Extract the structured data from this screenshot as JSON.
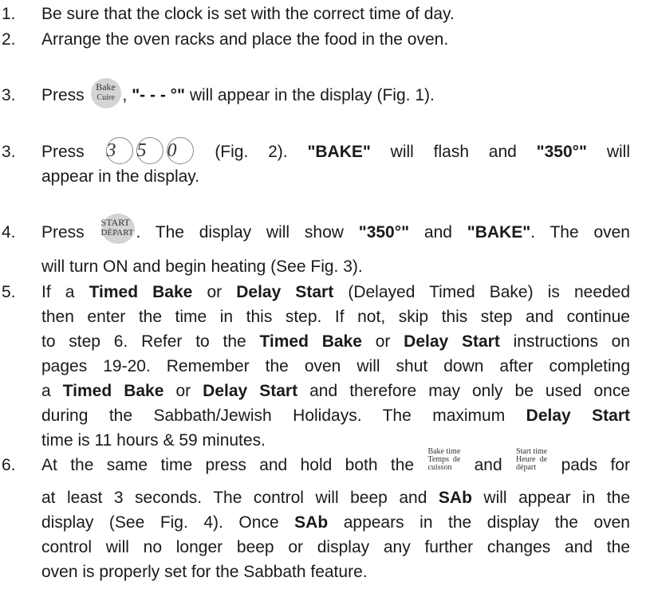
{
  "steps": {
    "s1": {
      "num": "1.",
      "text": "Be sure that the clock is set with the correct time of day."
    },
    "s2": {
      "num": "2.",
      "text": "Arrange the oven racks and place the food in the oven."
    },
    "s3a": {
      "num": "3.",
      "press": "Press",
      "pad_line1": "Bake",
      "pad_line2": "Cuire",
      "after_pad": ",",
      "display": "\"- - - °\"",
      "rest": "will appear in the display (Fig. 1)."
    },
    "s3b": {
      "num": "3.",
      "press": "Press",
      "digits": [
        "3",
        "5",
        "0"
      ],
      "fig": "(Fig. 2).",
      "bake": "\"BAKE\"",
      "mid": "will flash and",
      "temp": "\"350°\"",
      "end": "will",
      "line2": "appear in the display."
    },
    "s4": {
      "num": "4.",
      "press": "Press",
      "pad_line1": "START",
      "pad_line2": "DÉPART",
      "mid": ". The display will show",
      "temp": "\"350°\"",
      "and": "and",
      "bake": "\"BAKE\"",
      "end": ". The oven",
      "line2": "will turn ON and begin heating (See Fig. 3)."
    },
    "s5": {
      "num": "5.",
      "l1a": "If a",
      "tb": "Timed Bake",
      "l1b": "or",
      "ds": "Delay Start",
      "l1c": "(Delayed Timed Bake) is needed",
      "l2": "then enter the time in this step. If not, skip this step and continue",
      "l3a": "to step 6. Refer to the",
      "l3b": "or",
      "l3c": "instructions on",
      "l4": "pages 19-20. Remember the oven will shut down after completing",
      "l5a": "a",
      "l5b": "or",
      "l5c": "and therefore may only be used once",
      "l6a": "during the Sabbath/Jewish Holidays. The maximum",
      "l7": "time is 11 hours & 59 minutes."
    },
    "s6": {
      "num": "6.",
      "l1a": "At the same time press and hold both the",
      "bt1": "Bake time",
      "bt2": "Temps de",
      "bt3": "cuisson",
      "and": "and",
      "st1": "Start time",
      "st2": "Heure de",
      "st3": "départ",
      "l1b": "pads for",
      "l2a": "at least 3 seconds. The control will beep and",
      "sab": "SAb",
      "l2b": "will appear in the",
      "l3a": "display (See Fig. 4). Once",
      "l3b": "appears in the display the oven",
      "l4": "control will no longer beep or display any further changes and the",
      "l5": "oven is properly set for the Sabbath feature."
    }
  }
}
